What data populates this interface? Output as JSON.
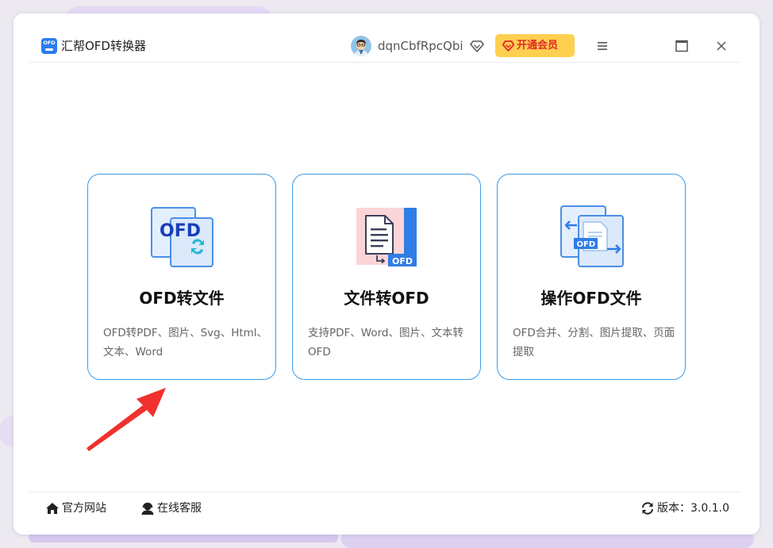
{
  "app": {
    "title": "汇帮OFD转换器",
    "logo_text": "OFD"
  },
  "header": {
    "username": "dqnCbfRpcQbi",
    "vip_label": "开通会员"
  },
  "cards": [
    {
      "title": "OFD转文件",
      "desc": "OFD转PDF、图片、Svg、Html、文本、Word",
      "icon_label": "OFD"
    },
    {
      "title": "文件转OFD",
      "desc": "支持PDF、Word、图片、文本转OFD",
      "icon_label": "OFD"
    },
    {
      "title": "操作OFD文件",
      "desc": "OFD合并、分割、图片提取、页面提取",
      "icon_label": "OFD"
    }
  ],
  "footer": {
    "website": "官方网站",
    "service": "在线客服",
    "version": "版本：3.0.1.0"
  },
  "colors": {
    "accent": "#3c9be9",
    "vip_bg": "#ffcf4f",
    "vip_text": "#e02a2a",
    "arrow": "#f0312d"
  }
}
